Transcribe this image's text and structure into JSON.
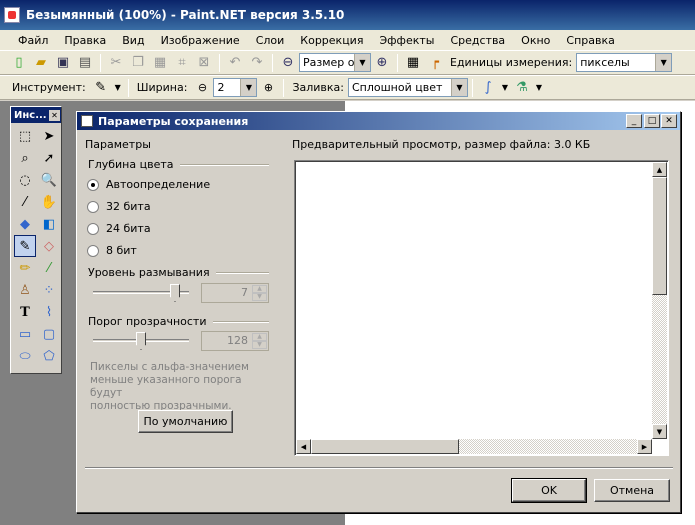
{
  "window": {
    "title": "Безымянный (100%) - Paint.NET версия 3.5.10"
  },
  "menu": [
    "Файл",
    "Правка",
    "Вид",
    "Изображение",
    "Слои",
    "Коррекция",
    "Эффекты",
    "Средства",
    "Окно",
    "Справка"
  ],
  "toolbar1": {
    "zoom_value": "Размер окн",
    "units_label": "Единицы измерения:",
    "units_value": "пикселы"
  },
  "toolbar2": {
    "tool_label": "Инструмент:",
    "width_label": "Ширина:",
    "width_value": "2",
    "fill_label": "Заливка:",
    "fill_value": "Сплошной цвет"
  },
  "tools_palette": {
    "title": "Инс..."
  },
  "dialog": {
    "title": "Параметры сохранения",
    "params_label": "Параметры",
    "preview_label": "Предварительный просмотр, размер файла: 3.0 КБ",
    "color_depth_label": "Глубина цвета",
    "options": [
      {
        "label": "Автоопределение",
        "checked": true
      },
      {
        "label": "32 бита",
        "checked": false
      },
      {
        "label": "24 бита",
        "checked": false
      },
      {
        "label": "8 бит",
        "checked": false
      }
    ],
    "dither_label": "Уровень размывания",
    "dither_value": "7",
    "dither_level": 0.89,
    "threshold_label": "Порог прозрачности",
    "threshold_value": "128",
    "threshold_level": 0.5,
    "hint": [
      "Пикселы с альфа-значением",
      "меньше указанного порога будут",
      "полностью прозрачными."
    ],
    "defaults_button": "По умолчанию",
    "ok_button": "OK",
    "cancel_button": "Отмена"
  },
  "colors": {
    "title_dark": "#0a246a",
    "title_light": "#a6caf0",
    "face": "#d4d0c8"
  }
}
